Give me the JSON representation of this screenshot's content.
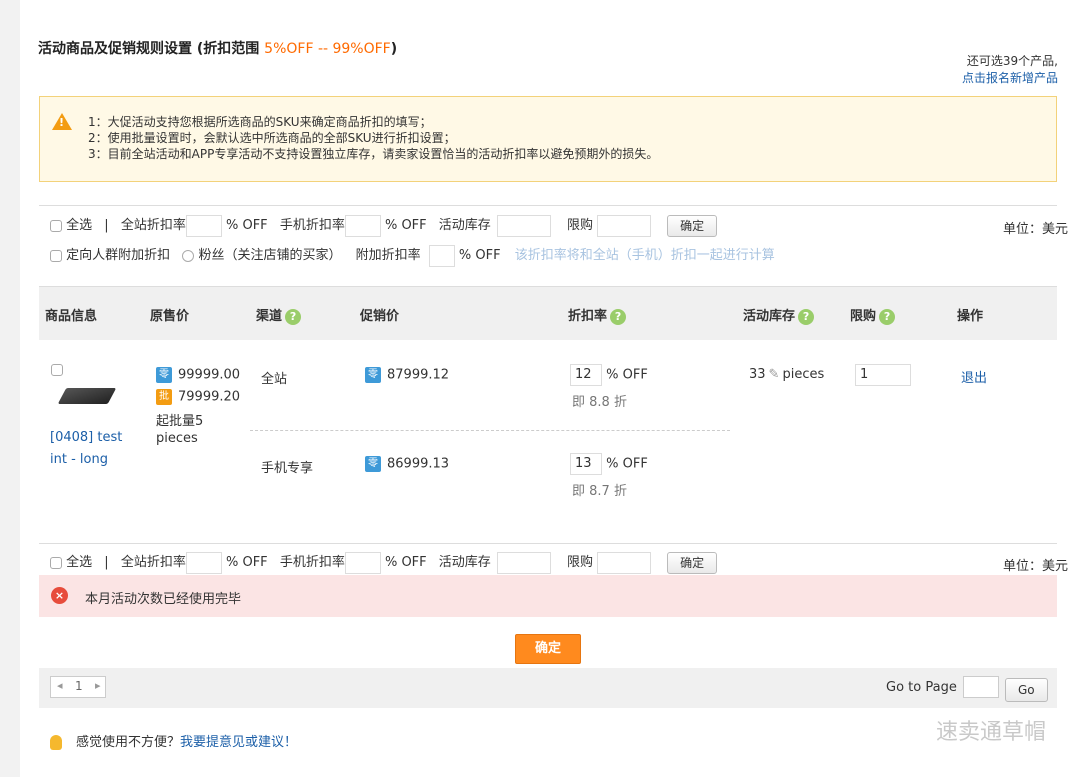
{
  "header": {
    "title": "活动商品及促销规则设置 (折扣范围 ",
    "range": "5%OFF -- 99%OFF",
    "title_end": ")",
    "remaining": "还可选39个产品,",
    "add_link": "点击报名新增产品"
  },
  "notice": {
    "lines": [
      "1：大促活动支持您根据所选商品的SKU来确定商品折扣的填写；",
      "2：使用批量设置时，会默认选中所选商品的全部SKU进行折扣设置；",
      "3：目前全站活动和APP专享活动不支持设置独立库存，请卖家设置恰当的活动折扣率以避免预期外的损失。"
    ]
  },
  "batch": {
    "select_all": "全选",
    "divider": "|",
    "site_rate": "全站折扣率",
    "off": "% OFF",
    "mobile_rate": "手机折扣率",
    "stock": "活动库存",
    "limit": "限购",
    "confirm": "确定",
    "unit": "单位：美元",
    "target_discount": "定向人群附加折扣",
    "fans": "粉丝（关注店铺的买家）",
    "extra_rate": "附加折扣率",
    "hint": "该折扣率将和全站（手机）折扣一起进行计算"
  },
  "table": {
    "headers": [
      "商品信息",
      "原售价",
      "渠道",
      "促销价",
      "折扣率",
      "活动库存",
      "限购",
      "操作"
    ],
    "help": "?",
    "product": {
      "name_line1": "[0408] test",
      "name_line2": "int - long",
      "retail_tag": "零",
      "retail_price": "99999.00",
      "wholesale_tag": "批",
      "wholesale_price": "79999.20",
      "moq_line1": "起批量5",
      "moq_line2": "pieces",
      "stock_value": "33",
      "stock_unit": "pieces",
      "limit_value": "1",
      "action": "退出"
    },
    "channels": [
      {
        "channel": "全站",
        "price": "87999.12",
        "rate": "12",
        "off": "% OFF",
        "equiv": "即 8.8 折"
      },
      {
        "channel": "手机专享",
        "price": "86999.13",
        "rate": "13",
        "off": "% OFF",
        "equiv": "即 8.7 折"
      }
    ]
  },
  "error": {
    "icon": "×",
    "message": "本月活动次数已经使用完毕"
  },
  "submit": "确定",
  "pagination": {
    "prev": "◂",
    "page": "1",
    "next": "▸",
    "goto_label": "Go to Page",
    "go": "Go"
  },
  "footer": {
    "text": "感觉使用不方便？",
    "link": "我要提意见或建议！"
  },
  "watermark": "速卖通草帽",
  "colors": {
    "accent": "#ff6a00",
    "link": "#1c5fa8",
    "help": "#9acd6a",
    "error": "#e74c3c"
  }
}
